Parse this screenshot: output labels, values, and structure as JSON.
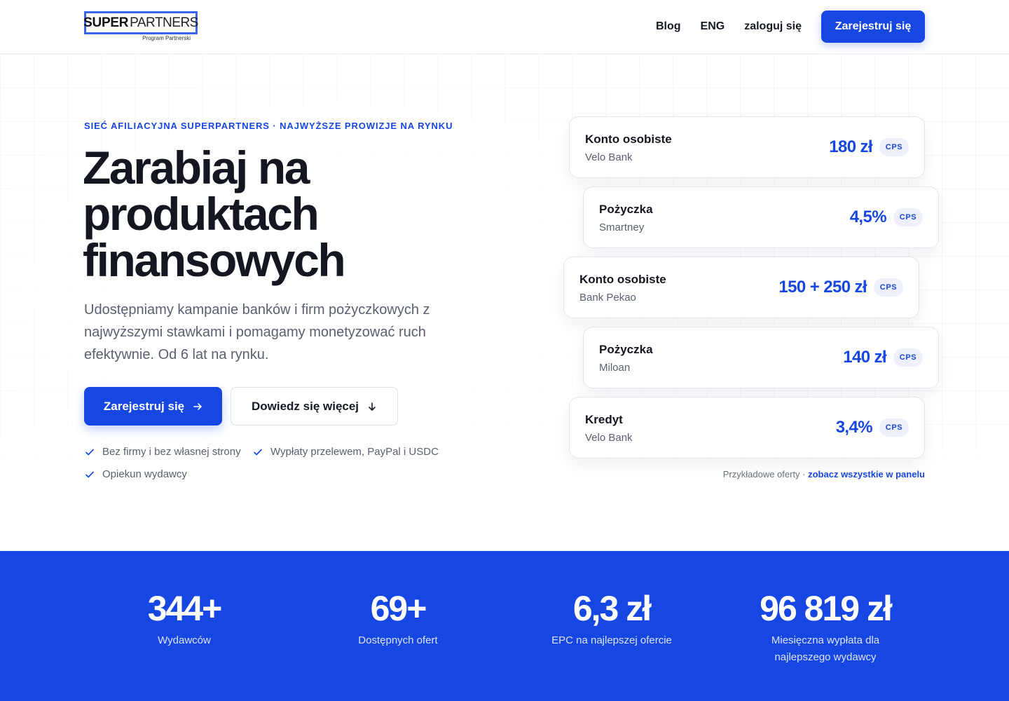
{
  "header": {
    "logo_super": "SUPER",
    "logo_partners": "PARTNERS",
    "logo_sub": "Program Partnerski",
    "nav": [
      "Blog",
      "ENG",
      "zaloguj się"
    ],
    "cta": "Zarejestruj się"
  },
  "hero": {
    "eyebrow": "SIEĆ AFILIACYJNA SUPERPARTNERS · NAJWYŻSZE PROWIZJE NA RYNKU",
    "title_lines": [
      "Zarabiaj na",
      "produktach",
      "finansowych"
    ],
    "lead": "Udostępniamy kampanie banków i firm pożyczkowych z najwyższymi stawkami i pomagamy monetyzować ruch efektywnie. Od 6 lat na rynku.",
    "primary_button": "Zarejestruj się",
    "secondary_button": "Dowiedz się więcej",
    "checks": [
      "Bez firmy i bez własnej strony",
      "Wypłaty przelewem, PayPal i USDC",
      "Opiekun wydawcy"
    ]
  },
  "offers": [
    {
      "type": "Konto osobiste",
      "bank": "Velo Bank",
      "value": "180 zł",
      "badge": "CPS"
    },
    {
      "type": "Pożyczka",
      "bank": "Smartney",
      "value": "4,5%",
      "badge": "CPS"
    },
    {
      "type": "Konto osobiste",
      "bank": "Bank Pekao",
      "value": "150 + 250 zł",
      "badge": "CPS"
    },
    {
      "type": "Pożyczka",
      "bank": "Miloan",
      "value": "140 zł",
      "badge": "CPS"
    },
    {
      "type": "Kredyt",
      "bank": "Velo Bank",
      "value": "3,4%",
      "badge": "CPS"
    }
  ],
  "offers_note": {
    "text": "Przykładowe oferty · ",
    "link": "zobacz wszystkie w panelu"
  },
  "stats": [
    {
      "value": "344+",
      "label": "Wydawców"
    },
    {
      "value": "69+",
      "label": "Dostępnych ofert"
    },
    {
      "value": "6,3 zł",
      "label": "EPC na najlepszej ofercie"
    },
    {
      "value": "96 819 zł",
      "label": "Miesięczna wypłata dla najlepszego wydawcy"
    }
  ],
  "colors": {
    "accent": "#1747e3",
    "text": "#14171f",
    "muted": "#5a6070"
  }
}
